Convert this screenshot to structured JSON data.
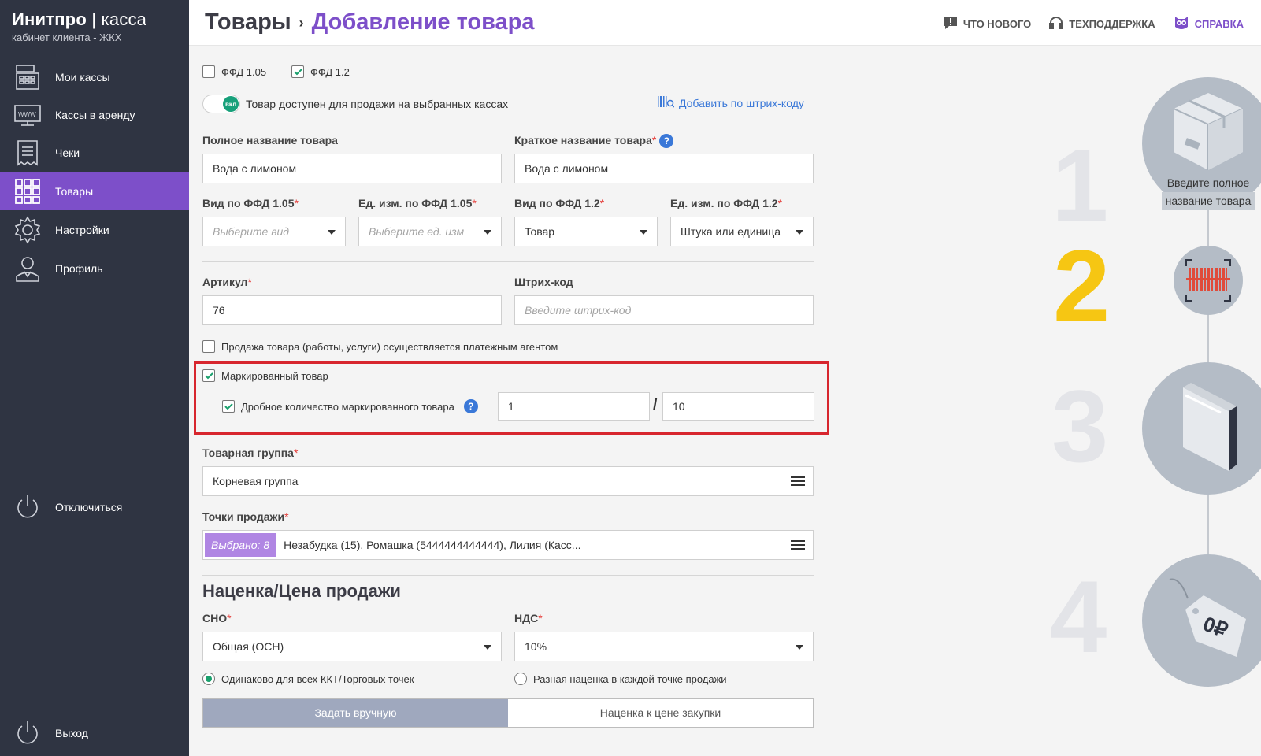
{
  "sidebar": {
    "brand_title": "Инитпро",
    "brand_title_sep": "|",
    "brand_title_suffix": "касса",
    "brand_subtitle": "кабинет клиента - ЖКХ",
    "items": [
      {
        "label": "Мои кассы",
        "icon": "cash-register-icon"
      },
      {
        "label": "Кассы в аренду",
        "icon": "www-monitor-icon"
      },
      {
        "label": "Чеки",
        "icon": "receipt-icon"
      },
      {
        "label": "Товары",
        "icon": "grid-icon"
      },
      {
        "label": "Настройки",
        "icon": "gear-icon"
      },
      {
        "label": "Профиль",
        "icon": "user-icon"
      }
    ],
    "disconnect_label": "Отключиться",
    "logout_label": "Выход",
    "active_color": "#7d4fc9"
  },
  "header": {
    "breadcrumb_root": "Товары",
    "breadcrumb_sep": "›",
    "breadcrumb_current": "Добавление товара",
    "links": {
      "news": "ЧТО НОВОГО",
      "support": "ТЕХПОДДЕРЖКА",
      "help": "СПРАВКА"
    }
  },
  "form": {
    "ffd105_label": "ФФД 1.05",
    "ffd105_checked": false,
    "ffd12_label": "ФФД 1.2",
    "ffd12_checked": true,
    "toggle_label": "вкл",
    "toggle_text": "Товар доступен для продажи на выбранных кассах",
    "barcode_add_link": "Добавить по штрих-коду",
    "full_name_label": "Полное название товара",
    "full_name_value": "Вода с лимоном",
    "short_name_label": "Краткое название товара",
    "short_name_value": "Вода с лимоном",
    "kind105_label": "Вид по ФФД 1.05",
    "kind105_placeholder": "Выберите вид",
    "unit105_label": "Ед. изм. по ФФД 1.05",
    "unit105_placeholder": "Выберите ед. изм",
    "kind12_label": "Вид по ФФД 1.2",
    "kind12_value": "Товар",
    "unit12_label": "Ед. изм. по ФФД 1.2",
    "unit12_value": "Штука или единица",
    "article_label": "Артикул",
    "article_value": "76",
    "barcode_label": "Штрих-код",
    "barcode_placeholder": "Введите штрих-код",
    "agent_label": "Продажа товара (работы, услуги) осуществляется платежным агентом",
    "agent_checked": false,
    "marked_label": "Маркированный товар",
    "marked_checked": true,
    "fractional_label": "Дробное количество маркированного товара",
    "fractional_checked": true,
    "fraction_numerator": "1",
    "fraction_slash": "/",
    "fraction_denominator": "10",
    "group_label": "Товарная группа",
    "group_value": "Корневая группа",
    "points_label": "Точки продажи",
    "points_badge": "Выбрано: 8",
    "points_value": "Незабудка (15), Ромашка (5444444444444), Лилия (Касс...",
    "section_title": "Наценка/Цена продажи",
    "sno_label": "СНО",
    "sno_value": "Общая (ОСН)",
    "nds_label": "НДС",
    "nds_value": "10%",
    "radio_same_label": "Одинаково для всех ККТ/Торговых точек",
    "radio_same_selected": true,
    "radio_diff_label": "Разная наценка в каждой точке продажи",
    "radio_diff_selected": false,
    "seg_manual": "Задать вручную",
    "seg_markup": "Наценка к цене закупки",
    "required_mark": "*",
    "help_mark": "?"
  },
  "steps": {
    "items": [
      {
        "number": "1",
        "icon": "box-icon"
      },
      {
        "number": "2",
        "icon": "barcode-icon"
      },
      {
        "number": "3",
        "icon": "folder-icon"
      },
      {
        "number": "4",
        "icon": "price-tag-icon"
      }
    ],
    "step1_caption_line1": "Введите полное",
    "step1_caption_line2": "название товара",
    "tag_text": "0₽",
    "active_step": "2",
    "active_color": "#f6c613"
  }
}
